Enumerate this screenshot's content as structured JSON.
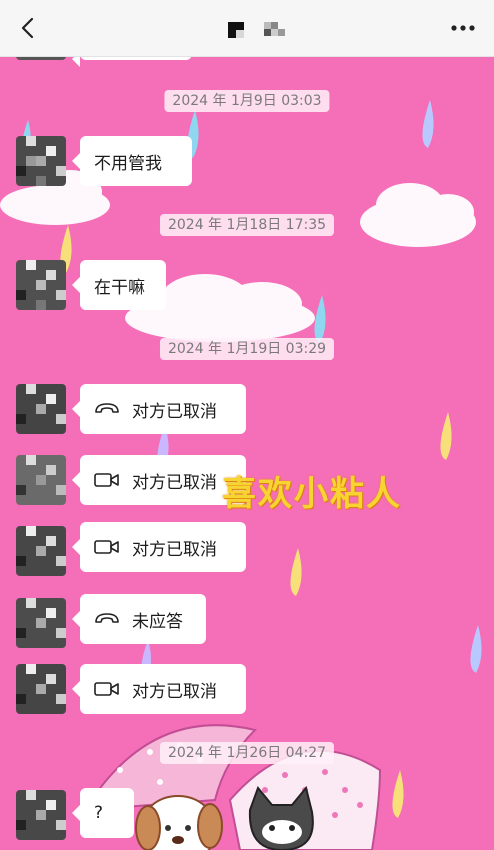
{
  "header": {
    "back_icon": "chevron-left-icon",
    "more_icon": "more-dots-icon",
    "title_mosaic": "pixelated-contact-name"
  },
  "overlay": {
    "text": "喜欢小粘人",
    "color": "#f7d431"
  },
  "colors": {
    "background": "#f56eb8",
    "bubble": "#ffffff",
    "timestamp_bg": "#fff0f8"
  },
  "messages": {
    "ts1": "2024 年 1月9日 03:03",
    "m1": "不用管我",
    "ts2": "2024 年 1月18日 17:35",
    "m2": "在干嘛",
    "ts3": "2024 年 1月19日 03:29",
    "call1": {
      "icon": "phone-icon",
      "text": "对方已取消"
    },
    "call2": {
      "icon": "video-call-icon",
      "text": "对方已取消"
    },
    "call3": {
      "icon": "video-call-icon",
      "text": "对方已取消"
    },
    "call4": {
      "icon": "phone-icon",
      "text": "未应答"
    },
    "call5": {
      "icon": "video-call-icon",
      "text": "对方已取消"
    },
    "ts4": "2024 年 1月26日 04:27",
    "m3": "?"
  }
}
